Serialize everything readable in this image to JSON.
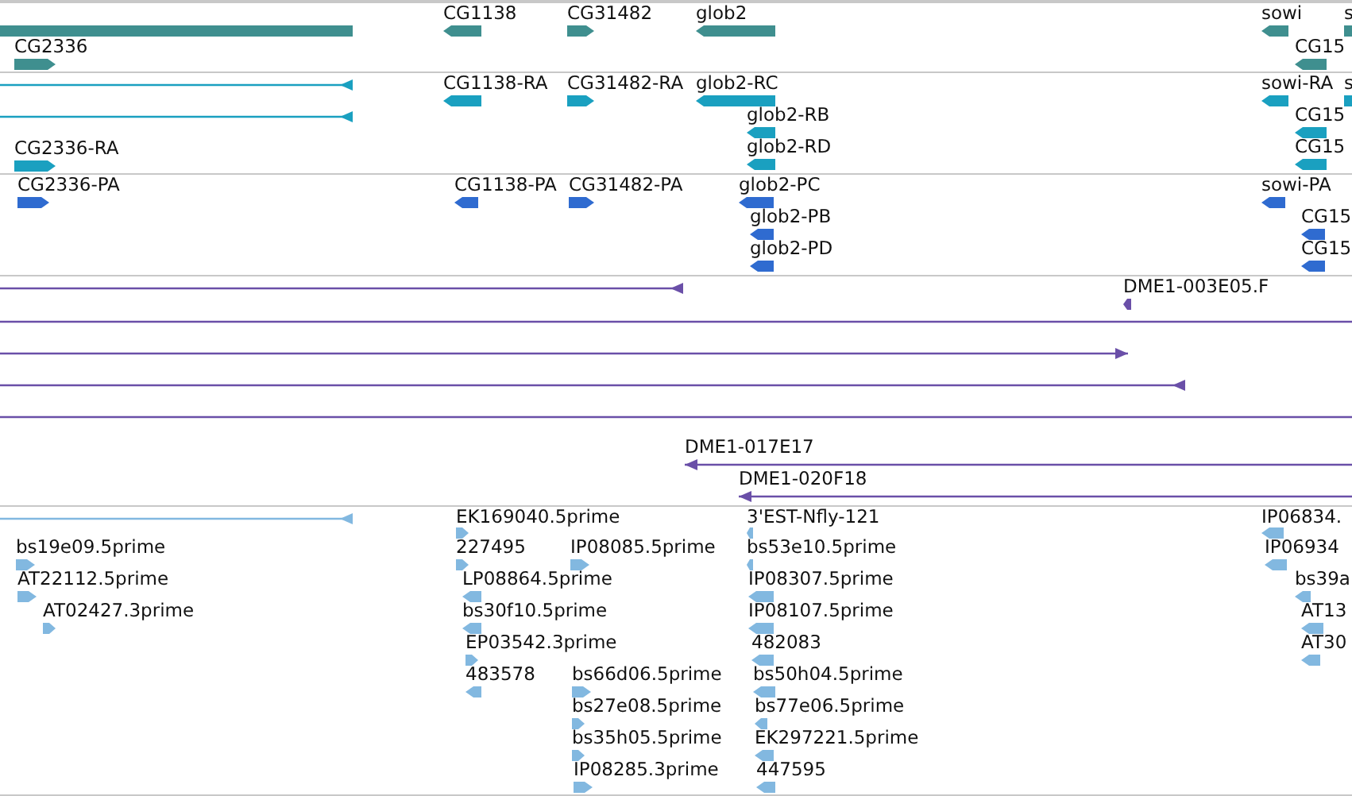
{
  "tracks": [
    {
      "kind": "gene",
      "features": [
        {
          "kind": "block"
        },
        {
          "kind": "block",
          "label": "CG2336",
          "reverse": false
        },
        {
          "kind": "block",
          "label": "CG1138",
          "reverse": true
        },
        {
          "kind": "block",
          "label": "CG31482",
          "reverse": false
        },
        {
          "kind": "block",
          "label": "glob2",
          "reverse": true
        },
        {
          "kind": "block",
          "label": "sowi",
          "reverse": true
        },
        {
          "kind": "block",
          "label": "s"
        },
        {
          "kind": "block",
          "label": "CG15",
          "reverse": true
        }
      ]
    },
    {
      "kind": "transcript",
      "features": [
        {
          "kind": "span",
          "reverse": true
        },
        {
          "kind": "span",
          "reverse": true
        },
        {
          "kind": "block",
          "label": "CG2336-RA",
          "reverse": false
        },
        {
          "kind": "block",
          "label": "CG1138-RA",
          "reverse": true
        },
        {
          "kind": "block",
          "label": "CG31482-RA",
          "reverse": false
        },
        {
          "kind": "block",
          "label": "glob2-RC",
          "reverse": true
        },
        {
          "kind": "block",
          "label": "glob2-RB",
          "reverse": true
        },
        {
          "kind": "block",
          "label": "glob2-RD",
          "reverse": true
        },
        {
          "kind": "block",
          "label": "sowi-RA",
          "reverse": true
        },
        {
          "kind": "block",
          "label": "s"
        },
        {
          "kind": "block",
          "label": "CG15",
          "reverse": true
        },
        {
          "kind": "block",
          "label": "CG15",
          "reverse": true
        }
      ]
    },
    {
      "kind": "protein",
      "features": [
        {
          "kind": "block",
          "label": "CG2336-PA",
          "reverse": false
        },
        {
          "kind": "block",
          "label": "CG1138-PA",
          "reverse": true
        },
        {
          "kind": "block",
          "label": "CG31482-PA",
          "reverse": false
        },
        {
          "kind": "block",
          "label": "glob2-PC",
          "reverse": true
        },
        {
          "kind": "block",
          "label": "glob2-PB",
          "reverse": true
        },
        {
          "kind": "block",
          "label": "glob2-PD",
          "reverse": true
        },
        {
          "kind": "block",
          "label": "sowi-PA",
          "reverse": true
        },
        {
          "kind": "block",
          "label": "CG15",
          "reverse": true
        },
        {
          "kind": "block",
          "label": "CG15",
          "reverse": true
        }
      ]
    },
    {
      "kind": "clone",
      "features": [
        {
          "kind": "span",
          "reverse": true
        },
        {
          "kind": "block",
          "label": "DME1-003E05.F",
          "reverse": true
        },
        {
          "kind": "span"
        },
        {
          "kind": "span",
          "reverse": false
        },
        {
          "kind": "span",
          "reverse": true
        },
        {
          "kind": "span"
        },
        {
          "kind": "span",
          "label": "DME1-017E17",
          "reverse": true
        },
        {
          "kind": "span",
          "label": "DME1-020F18",
          "reverse": true
        }
      ]
    },
    {
      "kind": "est",
      "features": [
        {
          "kind": "span",
          "reverse": true
        },
        {
          "kind": "block",
          "label": "bs19e09.5prime",
          "reverse": false
        },
        {
          "kind": "block",
          "label": "AT22112.5prime",
          "reverse": false
        },
        {
          "kind": "block",
          "label": "AT02427.3prime",
          "reverse": false
        },
        {
          "kind": "block",
          "label": "EK169040.5prime",
          "reverse": false
        },
        {
          "kind": "block",
          "label": "227495",
          "reverse": false
        },
        {
          "kind": "block",
          "label": "LP08864.5prime",
          "reverse": true
        },
        {
          "kind": "block",
          "label": "bs30f10.5prime",
          "reverse": true
        },
        {
          "kind": "block",
          "label": "EP03542.3prime",
          "reverse": false
        },
        {
          "kind": "block",
          "label": "483578",
          "reverse": true
        },
        {
          "kind": "block",
          "label": "IP08085.5prime",
          "reverse": false
        },
        {
          "kind": "block",
          "label": "bs66d06.5prime",
          "reverse": false
        },
        {
          "kind": "block",
          "label": "bs27e08.5prime",
          "reverse": false
        },
        {
          "kind": "block",
          "label": "bs35h05.5prime",
          "reverse": false
        },
        {
          "kind": "block",
          "label": "IP08285.3prime",
          "reverse": false
        },
        {
          "kind": "block",
          "label": "3'EST-Nfly-121",
          "reverse": true
        },
        {
          "kind": "block",
          "label": "bs53e10.5prime",
          "reverse": true
        },
        {
          "kind": "block",
          "label": "IP08307.5prime",
          "reverse": true
        },
        {
          "kind": "block",
          "label": "IP08107.5prime",
          "reverse": true
        },
        {
          "kind": "block",
          "label": "482083",
          "reverse": true
        },
        {
          "kind": "block",
          "label": "bs50h04.5prime",
          "reverse": true
        },
        {
          "kind": "block",
          "label": "bs77e06.5prime",
          "reverse": true
        },
        {
          "kind": "block",
          "label": "EK297221.5prime",
          "reverse": true
        },
        {
          "kind": "block",
          "label": "447595",
          "reverse": true
        },
        {
          "kind": "block",
          "label": "IP06834.",
          "reverse": true
        },
        {
          "kind": "block",
          "label": "IP06934",
          "reverse": true
        },
        {
          "kind": "block",
          "label": "bs39a",
          "reverse": true
        },
        {
          "kind": "block",
          "label": "AT13",
          "reverse": true
        },
        {
          "kind": "block",
          "label": "AT30",
          "reverse": true
        }
      ]
    }
  ]
}
